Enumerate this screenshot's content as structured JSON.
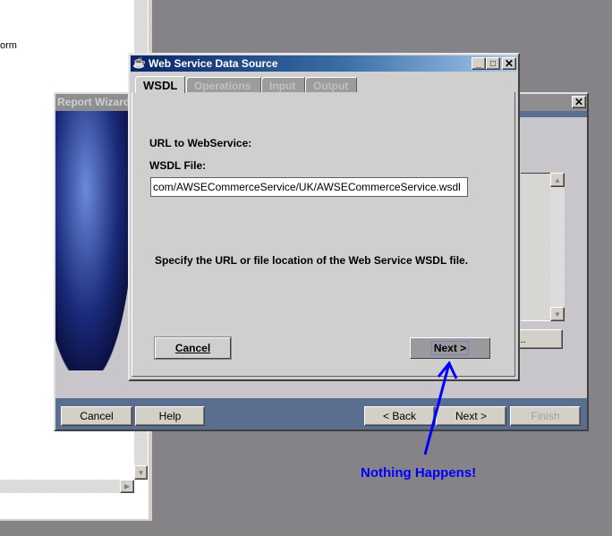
{
  "background_window": {
    "text": "orm"
  },
  "report_wizard": {
    "title": "Report Wizard",
    "buttons": {
      "cancel": "Cancel",
      "help": "Help",
      "back": "< Back",
      "next": "Next >",
      "finish": "Finish"
    },
    "side_button": "..."
  },
  "dialog": {
    "title": "Web Service Data Source",
    "tabs": [
      {
        "label": "WSDL",
        "active": true
      },
      {
        "label": "Operations",
        "enabled": false
      },
      {
        "label": "Input",
        "enabled": false
      },
      {
        "label": "Output",
        "enabled": false
      }
    ],
    "url_label": "URL to WebService:",
    "wsdl_label": "WSDL File:",
    "wsdl_value": "com/AWSECommerceService/UK/AWSECommerceService.wsdl",
    "hint": "Specify the URL or file location of the Web Service WSDL file.",
    "cancel": "Cancel",
    "next": "Next >"
  },
  "annotation": {
    "text": "Nothing Happens!",
    "color": "#0000ff"
  }
}
